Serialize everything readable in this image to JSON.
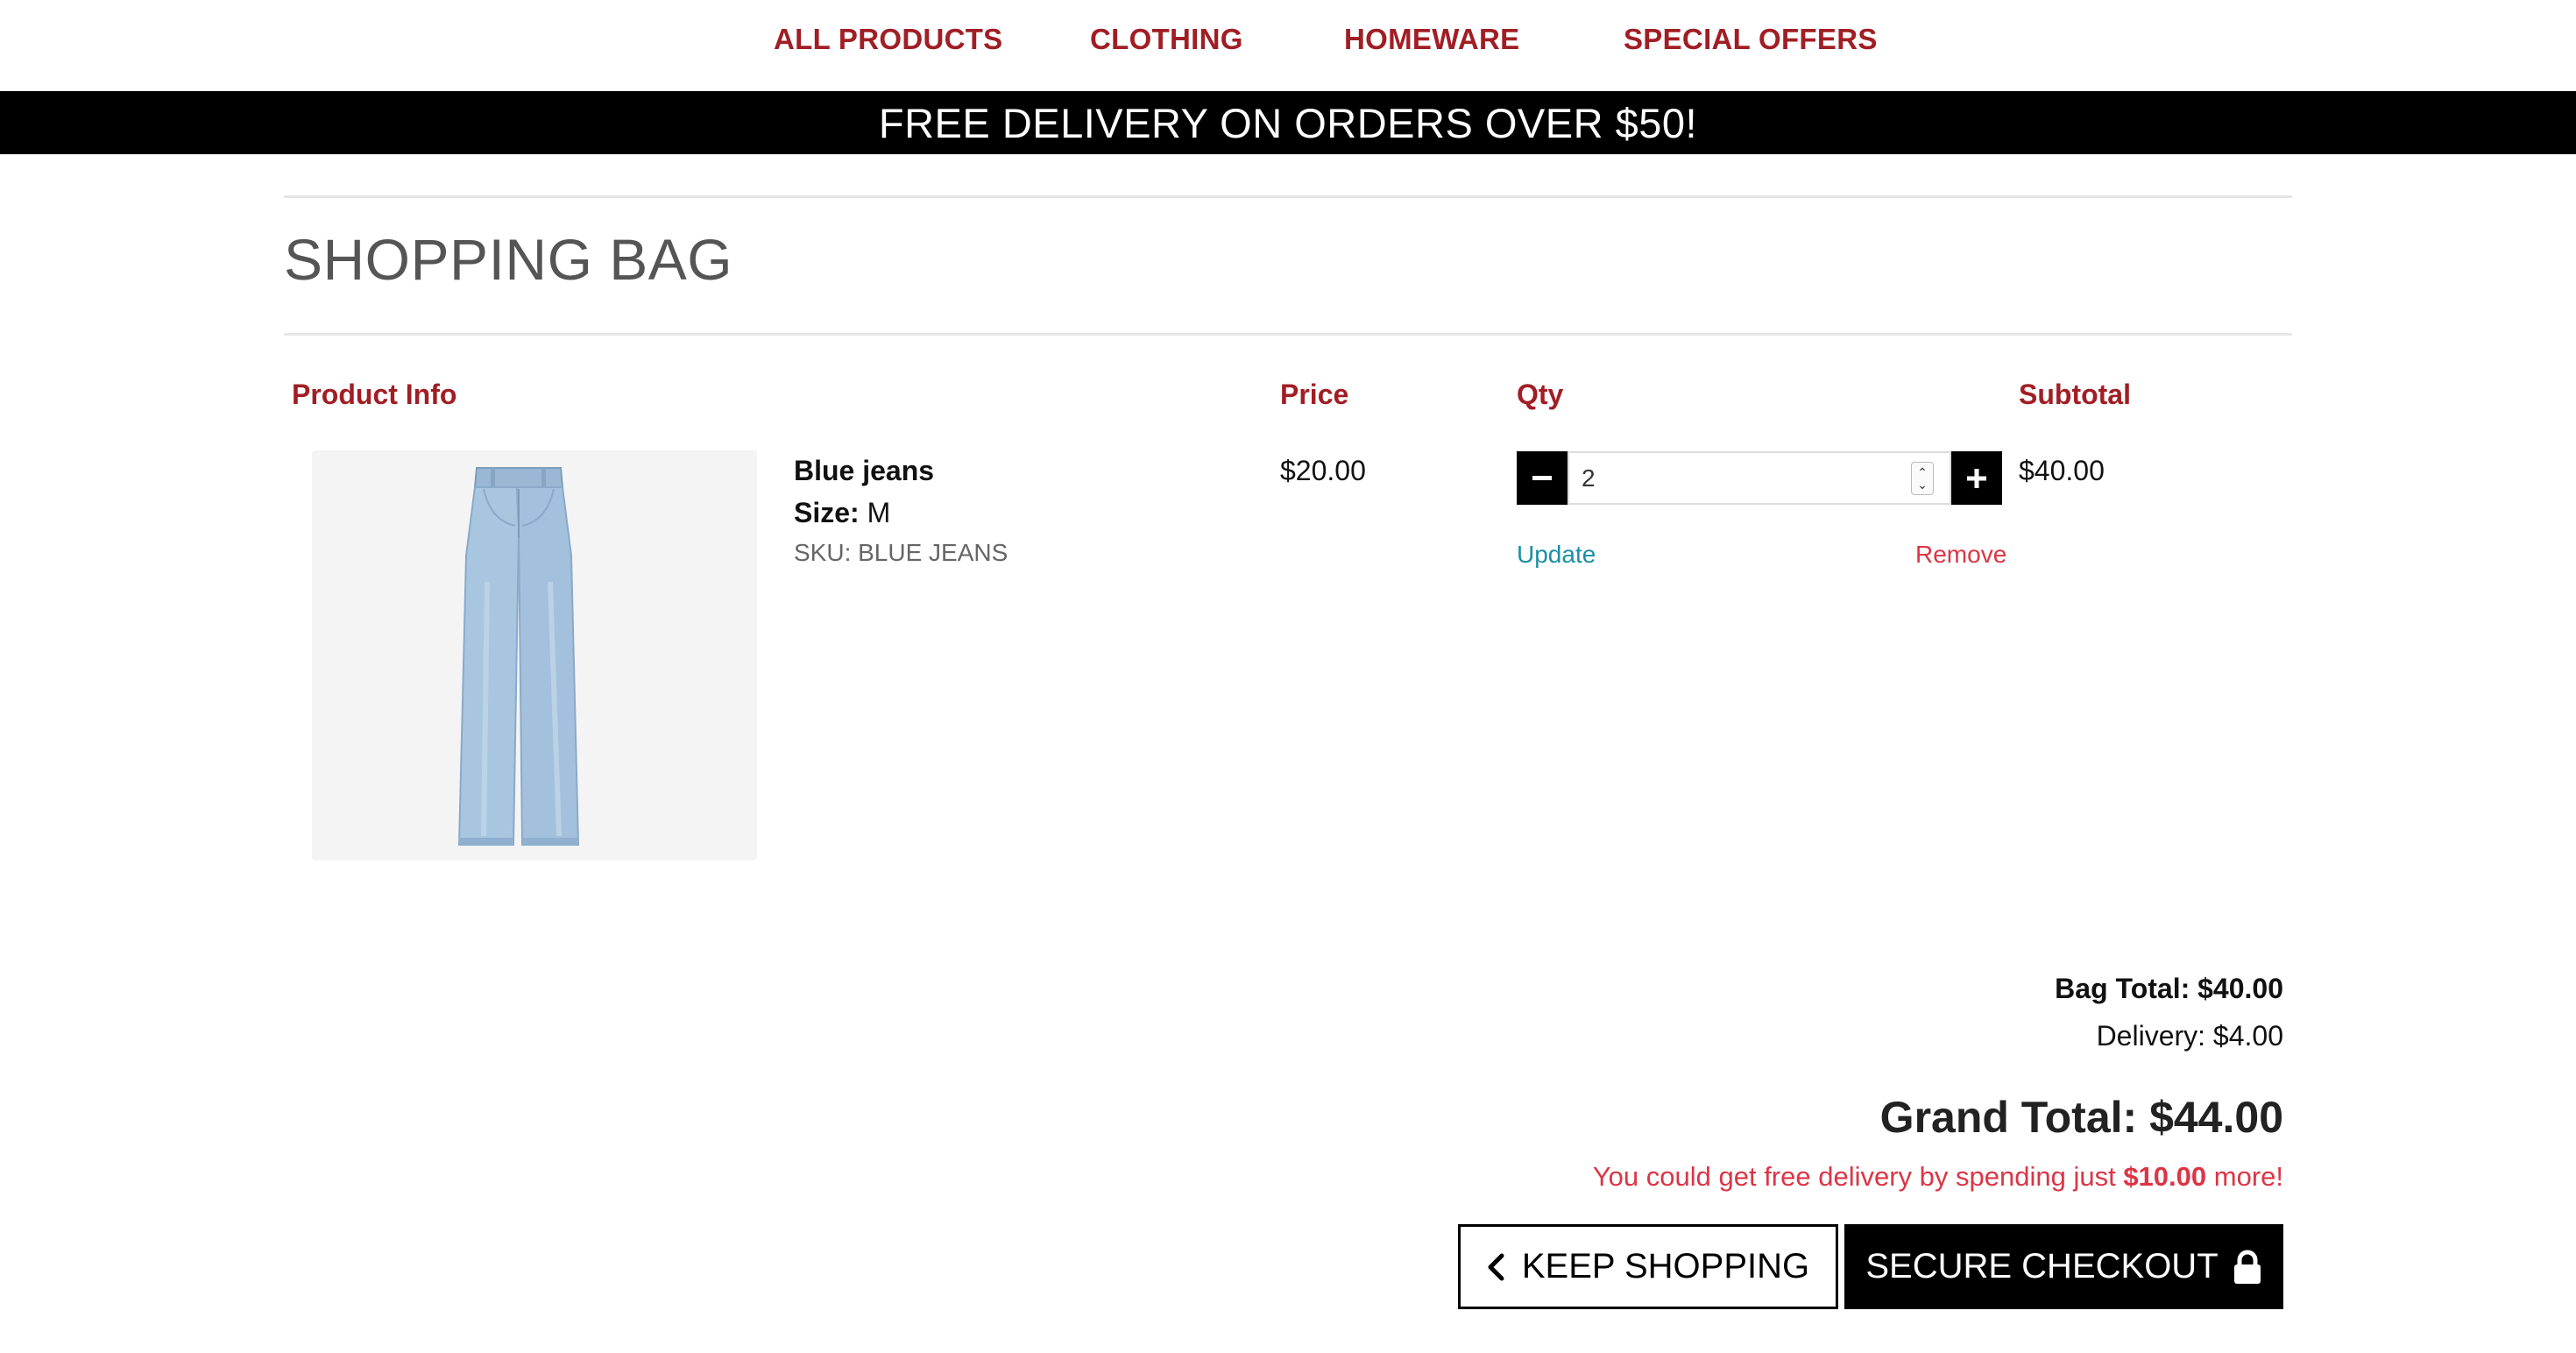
{
  "nav": {
    "items": [
      "ALL PRODUCTS",
      "CLOTHING",
      "HOMEWARE",
      "SPECIAL OFFERS"
    ]
  },
  "banner": {
    "text": "FREE DELIVERY ON ORDERS OVER $50!"
  },
  "page": {
    "title": "SHOPPING BAG"
  },
  "table": {
    "headers": {
      "product_info": "Product Info",
      "price": "Price",
      "qty": "Qty",
      "subtotal": "Subtotal"
    },
    "items": [
      {
        "name": "Blue jeans",
        "size_label": "Size:",
        "size_value": "M",
        "sku": "SKU: BLUE JEANS",
        "price": "$20.00",
        "quantity": "2",
        "update_label": "Update",
        "remove_label": "Remove",
        "subtotal": "$40.00",
        "image_icon": "blue-jeans-image"
      }
    ]
  },
  "summary": {
    "bag_total": "Bag Total: $40.00",
    "delivery": "Delivery: $4.00",
    "grand_total": "Grand Total: $44.00",
    "free_delivery_prefix": "You could get free delivery by spending just ",
    "free_delivery_amount": "$10.00",
    "free_delivery_suffix": " more!"
  },
  "buttons": {
    "keep_shopping": "KEEP SHOPPING",
    "secure_checkout": "SECURE CHECKOUT",
    "keep_shopping_icon": "chevron-left-icon",
    "secure_checkout_icon": "lock-icon"
  },
  "colors": {
    "brand_red": "#a01e24",
    "link_teal": "#1a8fa3",
    "danger_red": "#dc3545",
    "banner_bg": "#000000"
  }
}
